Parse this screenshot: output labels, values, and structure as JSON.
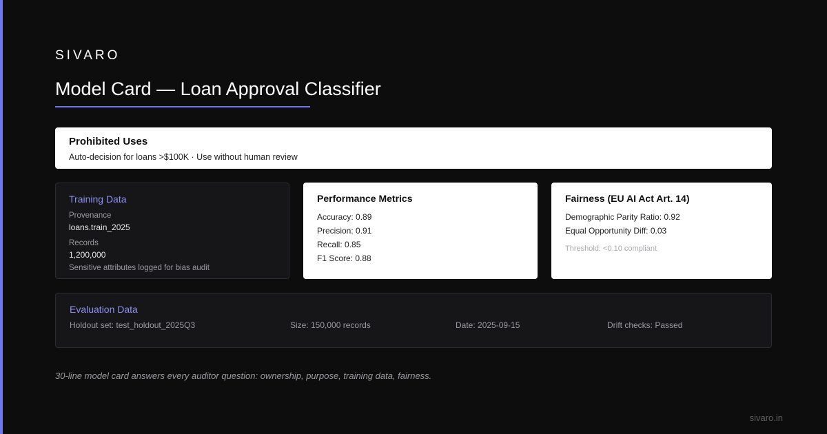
{
  "brand": "SIVARO",
  "title": "Model Card — Loan Approval Classifier",
  "colors": {
    "accent": "#6e78e8",
    "background": "#0d0d0d",
    "card_light": "#ffffff",
    "card_dark": "#161618"
  },
  "prohibited": {
    "heading": "Prohibited Uses",
    "text": "Auto-decision for loans >$100K · Use without human review"
  },
  "training": {
    "heading": "Training Data",
    "provenance_label": "Provenance",
    "provenance_value": "loans.train_2025",
    "records_label": "Records",
    "records_value": "1,200,000",
    "note": "Sensitive attributes logged for bias audit"
  },
  "performance": {
    "heading": "Performance Metrics",
    "metrics": [
      "Accuracy: 0.89",
      "Precision: 0.91",
      "Recall: 0.85",
      "F1 Score: 0.88"
    ]
  },
  "fairness": {
    "heading": "Fairness (EU AI Act Art. 14)",
    "metrics": [
      "Demographic Parity Ratio: 0.92",
      "Equal Opportunity Diff: 0.03"
    ],
    "threshold": "Threshold: <0.10 compliant"
  },
  "evaluation": {
    "heading": "Evaluation Data",
    "holdout": "Holdout set: test_holdout_2025Q3",
    "size": "Size: 150,000 records",
    "date": "Date: 2025-09-15",
    "drift": "Drift checks: Passed"
  },
  "caption": "30-line model card answers every auditor question: ownership, purpose, training data, fairness.",
  "footer": "sivaro.in"
}
